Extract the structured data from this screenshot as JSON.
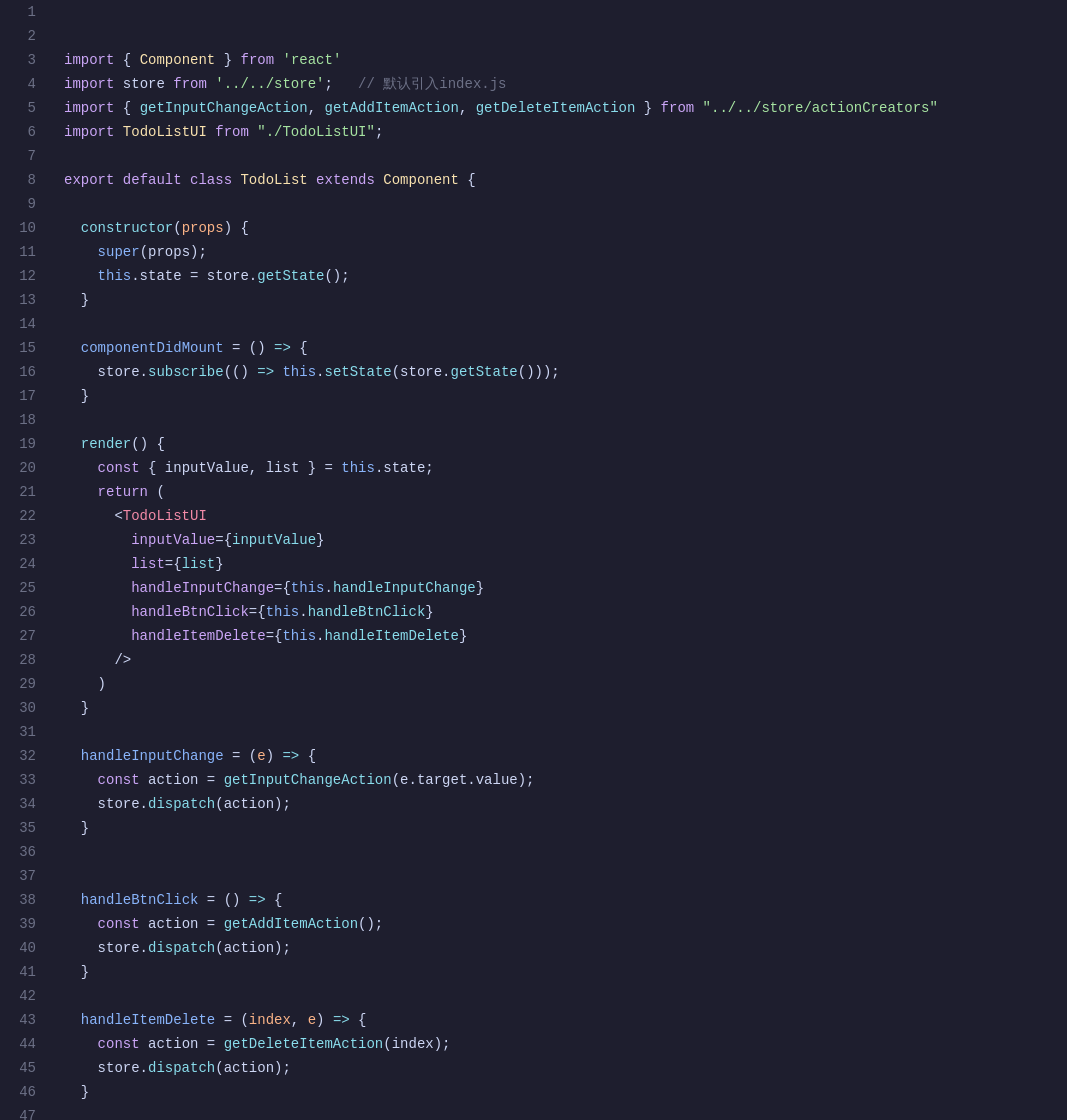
{
  "editor": {
    "background": "#1e1e2e",
    "lines": [
      {
        "num": 1,
        "tokens": [
          {
            "t": "kw",
            "v": "import"
          },
          {
            "t": "white",
            "v": " { "
          },
          {
            "t": "cls",
            "v": "Component"
          },
          {
            "t": "white",
            "v": " } "
          },
          {
            "t": "kw",
            "v": "from"
          },
          {
            "t": "white",
            "v": " "
          },
          {
            "t": "str",
            "v": "'react'"
          }
        ]
      },
      {
        "num": 2,
        "tokens": [
          {
            "t": "kw",
            "v": "import"
          },
          {
            "t": "white",
            "v": " store "
          },
          {
            "t": "kw",
            "v": "from"
          },
          {
            "t": "white",
            "v": " "
          },
          {
            "t": "str",
            "v": "'../../store'"
          },
          {
            "t": "white",
            "v": ";   "
          },
          {
            "t": "cmt",
            "v": "// 默认引入index.js"
          }
        ]
      },
      {
        "num": 3,
        "tokens": [
          {
            "t": "kw",
            "v": "import"
          },
          {
            "t": "white",
            "v": " { "
          },
          {
            "t": "fn",
            "v": "getInputChangeAction"
          },
          {
            "t": "white",
            "v": ", "
          },
          {
            "t": "fn",
            "v": "getAddItemAction"
          },
          {
            "t": "white",
            "v": ", "
          },
          {
            "t": "fn",
            "v": "getDeleteItemAction"
          },
          {
            "t": "white",
            "v": " } "
          },
          {
            "t": "kw",
            "v": "from"
          },
          {
            "t": "white",
            "v": " "
          },
          {
            "t": "str",
            "v": "\"../../store/actionCreators\""
          }
        ]
      },
      {
        "num": 4,
        "tokens": [
          {
            "t": "kw",
            "v": "import"
          },
          {
            "t": "white",
            "v": " "
          },
          {
            "t": "cls",
            "v": "TodoListUI"
          },
          {
            "t": "white",
            "v": " "
          },
          {
            "t": "kw",
            "v": "from"
          },
          {
            "t": "white",
            "v": " "
          },
          {
            "t": "str",
            "v": "\"./TodoListUI\""
          },
          {
            "t": "white",
            "v": ";"
          }
        ]
      },
      {
        "num": 5,
        "tokens": []
      },
      {
        "num": 6,
        "tokens": [
          {
            "t": "kw",
            "v": "export"
          },
          {
            "t": "white",
            "v": " "
          },
          {
            "t": "kw",
            "v": "default"
          },
          {
            "t": "white",
            "v": " "
          },
          {
            "t": "kw",
            "v": "class"
          },
          {
            "t": "white",
            "v": " "
          },
          {
            "t": "cls",
            "v": "TodoList"
          },
          {
            "t": "white",
            "v": " "
          },
          {
            "t": "kw",
            "v": "extends"
          },
          {
            "t": "white",
            "v": " "
          },
          {
            "t": "cls",
            "v": "Component"
          },
          {
            "t": "white",
            "v": " {"
          }
        ]
      },
      {
        "num": 7,
        "tokens": []
      },
      {
        "num": 8,
        "tokens": [
          {
            "t": "white",
            "v": "  "
          },
          {
            "t": "fn",
            "v": "constructor"
          },
          {
            "t": "white",
            "v": "("
          },
          {
            "t": "param",
            "v": "props"
          },
          {
            "t": "white",
            "v": ") {"
          }
        ]
      },
      {
        "num": 9,
        "tokens": [
          {
            "t": "white",
            "v": "    "
          },
          {
            "t": "kw2",
            "v": "super"
          },
          {
            "t": "white",
            "v": "(props);"
          }
        ]
      },
      {
        "num": 10,
        "tokens": [
          {
            "t": "white",
            "v": "    "
          },
          {
            "t": "kw2",
            "v": "this"
          },
          {
            "t": "white",
            "v": ".state = store."
          },
          {
            "t": "method",
            "v": "getState"
          },
          {
            "t": "white",
            "v": "();"
          }
        ]
      },
      {
        "num": 11,
        "tokens": [
          {
            "t": "white",
            "v": "  }"
          }
        ]
      },
      {
        "num": 12,
        "tokens": []
      },
      {
        "num": 13,
        "tokens": [
          {
            "t": "white",
            "v": "  "
          },
          {
            "t": "prop",
            "v": "componentDidMount"
          },
          {
            "t": "white",
            "v": " = () "
          },
          {
            "t": "op",
            "v": "=>"
          },
          {
            "t": "white",
            "v": " {"
          }
        ]
      },
      {
        "num": 14,
        "tokens": [
          {
            "t": "white",
            "v": "    store."
          },
          {
            "t": "method",
            "v": "subscribe"
          },
          {
            "t": "white",
            "v": "(() "
          },
          {
            "t": "op",
            "v": "=>"
          },
          {
            "t": "white",
            "v": " "
          },
          {
            "t": "kw2",
            "v": "this"
          },
          {
            "t": "white",
            "v": "."
          },
          {
            "t": "method",
            "v": "setState"
          },
          {
            "t": "white",
            "v": "(store."
          },
          {
            "t": "method",
            "v": "getState"
          },
          {
            "t": "white",
            "v": "()));"
          }
        ]
      },
      {
        "num": 15,
        "tokens": [
          {
            "t": "white",
            "v": "  }"
          }
        ]
      },
      {
        "num": 16,
        "tokens": []
      },
      {
        "num": 17,
        "tokens": [
          {
            "t": "white",
            "v": "  "
          },
          {
            "t": "fn",
            "v": "render"
          },
          {
            "t": "white",
            "v": "() {"
          }
        ]
      },
      {
        "num": 18,
        "tokens": [
          {
            "t": "white",
            "v": "    "
          },
          {
            "t": "kw",
            "v": "const"
          },
          {
            "t": "white",
            "v": " { "
          },
          {
            "t": "var",
            "v": "inputValue"
          },
          {
            "t": "white",
            "v": ", "
          },
          {
            "t": "var",
            "v": "list"
          },
          {
            "t": "white",
            "v": " } = "
          },
          {
            "t": "kw2",
            "v": "this"
          },
          {
            "t": "white",
            "v": ".state;"
          }
        ]
      },
      {
        "num": 19,
        "tokens": [
          {
            "t": "white",
            "v": "    "
          },
          {
            "t": "kw",
            "v": "return"
          },
          {
            "t": "white",
            "v": " ("
          }
        ]
      },
      {
        "num": 20,
        "tokens": [
          {
            "t": "white",
            "v": "      <"
          },
          {
            "t": "jsx-tag",
            "v": "TodoListUI"
          }
        ]
      },
      {
        "num": 21,
        "tokens": [
          {
            "t": "white",
            "v": "        "
          },
          {
            "t": "jsx-attr",
            "v": "inputValue"
          },
          {
            "t": "white",
            "v": "={"
          },
          {
            "t": "jsx-val",
            "v": "inputValue"
          },
          {
            "t": "white",
            "v": "}"
          }
        ]
      },
      {
        "num": 22,
        "tokens": [
          {
            "t": "white",
            "v": "        "
          },
          {
            "t": "jsx-attr",
            "v": "list"
          },
          {
            "t": "white",
            "v": "={"
          },
          {
            "t": "jsx-val",
            "v": "list"
          },
          {
            "t": "white",
            "v": "}"
          }
        ]
      },
      {
        "num": 23,
        "tokens": [
          {
            "t": "white",
            "v": "        "
          },
          {
            "t": "jsx-attr",
            "v": "handleInputChange"
          },
          {
            "t": "white",
            "v": "={"
          },
          {
            "t": "kw2",
            "v": "this"
          },
          {
            "t": "white",
            "v": "."
          },
          {
            "t": "jsx-val",
            "v": "handleInputChange"
          },
          {
            "t": "white",
            "v": "}"
          }
        ]
      },
      {
        "num": 24,
        "tokens": [
          {
            "t": "white",
            "v": "        "
          },
          {
            "t": "jsx-attr",
            "v": "handleBtnClick"
          },
          {
            "t": "white",
            "v": "={"
          },
          {
            "t": "kw2",
            "v": "this"
          },
          {
            "t": "white",
            "v": "."
          },
          {
            "t": "jsx-val",
            "v": "handleBtnClick"
          },
          {
            "t": "white",
            "v": "}"
          }
        ]
      },
      {
        "num": 25,
        "tokens": [
          {
            "t": "white",
            "v": "        "
          },
          {
            "t": "jsx-attr",
            "v": "handleItemDelete"
          },
          {
            "t": "white",
            "v": "={"
          },
          {
            "t": "kw2",
            "v": "this"
          },
          {
            "t": "white",
            "v": "."
          },
          {
            "t": "jsx-val",
            "v": "handleItemDelete"
          },
          {
            "t": "white",
            "v": "}"
          }
        ]
      },
      {
        "num": 26,
        "tokens": [
          {
            "t": "white",
            "v": "      />"
          }
        ]
      },
      {
        "num": 27,
        "tokens": [
          {
            "t": "white",
            "v": "    )"
          }
        ]
      },
      {
        "num": 28,
        "tokens": [
          {
            "t": "white",
            "v": "  }"
          }
        ]
      },
      {
        "num": 29,
        "tokens": []
      },
      {
        "num": 30,
        "tokens": [
          {
            "t": "white",
            "v": "  "
          },
          {
            "t": "prop",
            "v": "handleInputChange"
          },
          {
            "t": "white",
            "v": " = ("
          },
          {
            "t": "param",
            "v": "e"
          },
          {
            "t": "white",
            "v": ") "
          },
          {
            "t": "op",
            "v": "=>"
          },
          {
            "t": "white",
            "v": " {"
          }
        ]
      },
      {
        "num": 31,
        "tokens": [
          {
            "t": "white",
            "v": "    "
          },
          {
            "t": "kw",
            "v": "const"
          },
          {
            "t": "white",
            "v": " action = "
          },
          {
            "t": "fn",
            "v": "getInputChangeAction"
          },
          {
            "t": "white",
            "v": "(e.target.value);"
          }
        ]
      },
      {
        "num": 32,
        "tokens": [
          {
            "t": "white",
            "v": "    store."
          },
          {
            "t": "method",
            "v": "dispatch"
          },
          {
            "t": "white",
            "v": "(action);"
          }
        ]
      },
      {
        "num": 33,
        "tokens": [
          {
            "t": "white",
            "v": "  }"
          }
        ]
      },
      {
        "num": 34,
        "tokens": []
      },
      {
        "num": 35,
        "tokens": []
      },
      {
        "num": 36,
        "tokens": [
          {
            "t": "white",
            "v": "  "
          },
          {
            "t": "prop",
            "v": "handleBtnClick"
          },
          {
            "t": "white",
            "v": " = () "
          },
          {
            "t": "op",
            "v": "=>"
          },
          {
            "t": "white",
            "v": " {"
          }
        ]
      },
      {
        "num": 37,
        "tokens": [
          {
            "t": "white",
            "v": "    "
          },
          {
            "t": "kw",
            "v": "const"
          },
          {
            "t": "white",
            "v": " action = "
          },
          {
            "t": "fn",
            "v": "getAddItemAction"
          },
          {
            "t": "white",
            "v": "();"
          }
        ]
      },
      {
        "num": 38,
        "tokens": [
          {
            "t": "white",
            "v": "    store."
          },
          {
            "t": "method",
            "v": "dispatch"
          },
          {
            "t": "white",
            "v": "(action);"
          }
        ]
      },
      {
        "num": 39,
        "tokens": [
          {
            "t": "white",
            "v": "  }"
          }
        ]
      },
      {
        "num": 40,
        "tokens": []
      },
      {
        "num": 41,
        "tokens": [
          {
            "t": "white",
            "v": "  "
          },
          {
            "t": "prop",
            "v": "handleItemDelete"
          },
          {
            "t": "white",
            "v": " = ("
          },
          {
            "t": "param",
            "v": "index"
          },
          {
            "t": "white",
            "v": ", "
          },
          {
            "t": "param",
            "v": "e"
          },
          {
            "t": "white",
            "v": ") "
          },
          {
            "t": "op",
            "v": "=>"
          },
          {
            "t": "white",
            "v": " {"
          }
        ]
      },
      {
        "num": 42,
        "tokens": [
          {
            "t": "white",
            "v": "    "
          },
          {
            "t": "kw",
            "v": "const"
          },
          {
            "t": "white",
            "v": " action = "
          },
          {
            "t": "fn",
            "v": "getDeleteItemAction"
          },
          {
            "t": "white",
            "v": "(index);"
          }
        ]
      },
      {
        "num": 43,
        "tokens": [
          {
            "t": "white",
            "v": "    store."
          },
          {
            "t": "method",
            "v": "dispatch"
          },
          {
            "t": "white",
            "v": "(action);"
          }
        ]
      },
      {
        "num": 44,
        "tokens": [
          {
            "t": "white",
            "v": "  }"
          }
        ]
      },
      {
        "num": 45,
        "tokens": []
      },
      {
        "num": 46,
        "tokens": [
          {
            "t": "white",
            "v": "}"
          }
        ]
      },
      {
        "num": 47,
        "tokens": []
      }
    ]
  }
}
